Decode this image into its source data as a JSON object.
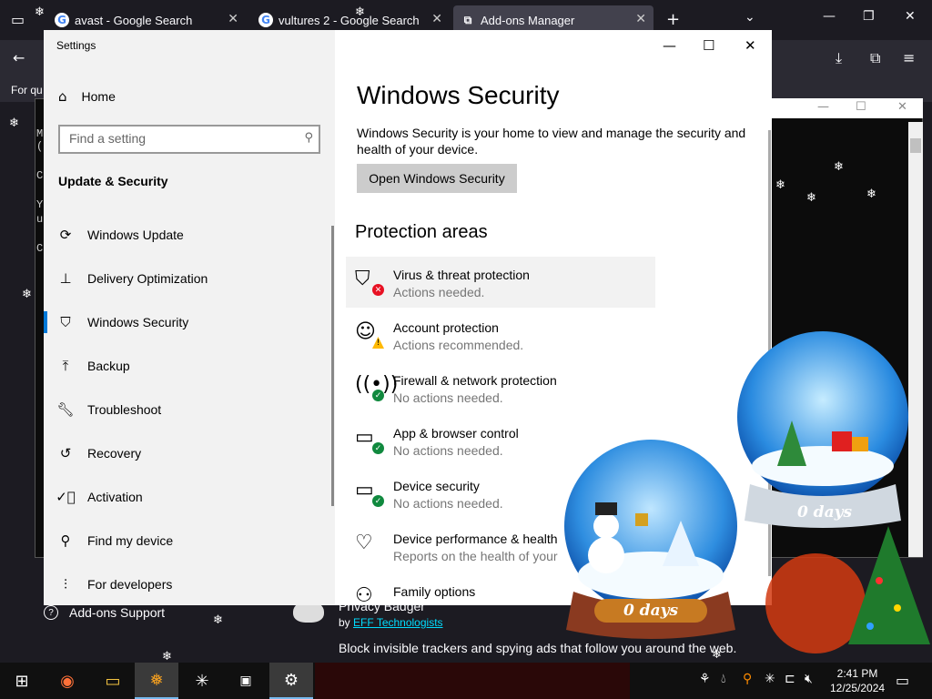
{
  "browser": {
    "tabs": [
      {
        "title": "avast - Google Search",
        "favicon": "G"
      },
      {
        "title": "vultures 2 - Google Search",
        "favicon": "G"
      },
      {
        "title": "Add-ons Manager",
        "favicon": "puzzle"
      }
    ],
    "bookmark_text": "For qu"
  },
  "addons_page": {
    "support_label": "Add-ons Support",
    "extension_name": "Privacy Badger",
    "by_prefix": "by",
    "author": "EFF Technologists",
    "description": "Block invisible trackers and spying ads that follow you around the web."
  },
  "terminal": {
    "lines": [
      "M",
      "(",
      "C",
      "Y",
      "u",
      "C"
    ]
  },
  "settings": {
    "window_title": "Settings",
    "home_label": "Home",
    "search_placeholder": "Find a setting",
    "group_title": "Update & Security",
    "nav": [
      {
        "label": "Windows Update",
        "icon": "refresh-icon"
      },
      {
        "label": "Delivery Optimization",
        "icon": "delivery-icon"
      },
      {
        "label": "Windows Security",
        "icon": "shield-icon",
        "active": true
      },
      {
        "label": "Backup",
        "icon": "backup-arrow-icon"
      },
      {
        "label": "Troubleshoot",
        "icon": "wrench-icon"
      },
      {
        "label": "Recovery",
        "icon": "recovery-icon"
      },
      {
        "label": "Activation",
        "icon": "check-circle-icon"
      },
      {
        "label": "Find my device",
        "icon": "person-pin-icon"
      },
      {
        "label": "For developers",
        "icon": "developer-icon"
      }
    ],
    "main": {
      "title": "Windows Security",
      "description": "Windows Security is your home to view and manage the security and health of your device.",
      "open_button": "Open Windows Security",
      "areas_title": "Protection areas",
      "areas": [
        {
          "name": "Virus & threat protection",
          "status": "Actions needed.",
          "icon": "virus-shield-icon",
          "badge": "red"
        },
        {
          "name": "Account protection",
          "status": "Actions recommended.",
          "icon": "account-icon",
          "badge": "yellow"
        },
        {
          "name": "Firewall & network protection",
          "status": "No actions needed.",
          "icon": "firewall-icon",
          "badge": "green"
        },
        {
          "name": "App & browser control",
          "status": "No actions needed.",
          "icon": "app-browser-icon",
          "badge": "green"
        },
        {
          "name": "Device security",
          "status": "No actions needed.",
          "icon": "device-security-icon",
          "badge": "green"
        },
        {
          "name": "Device performance & health",
          "status": "Reports on the health of your",
          "icon": "heart-icon",
          "badge": ""
        },
        {
          "name": "Family options",
          "status": "",
          "icon": "family-icon",
          "badge": ""
        }
      ]
    }
  },
  "globes": {
    "left_days": "0 days",
    "right_days": "0 days"
  },
  "taskbar": {
    "time": "2:41 PM",
    "date": "12/25/2024"
  }
}
